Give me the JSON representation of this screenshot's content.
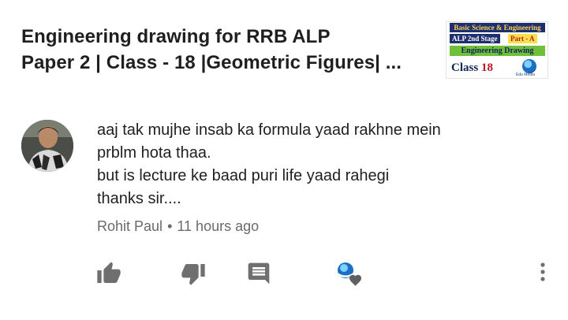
{
  "video": {
    "title_line1": "Engineering drawing for RRB ALP",
    "title_line2": "Paper 2 | Class - 18 |Geometric Figures| ...",
    "thumbnail": {
      "line1": "Basic Science & Engineering",
      "stage": "ALP 2nd Stage",
      "part": "Part - A",
      "subject": "Engineering Drawing",
      "class_label": "Class",
      "class_number": "18",
      "logo_text": "Edu Media"
    }
  },
  "comment": {
    "lines": [
      "aaj tak mujhe insab ka formula yaad rakhne mein",
      "prblm hota thaa.",
      "but is lecture ke baad puri life yaad rahegi",
      "thanks sir...."
    ],
    "author": "Rohit Paul",
    "separator": "•",
    "time": "11 hours ago"
  },
  "actions": {
    "like_icon": "thumbs-up-icon",
    "dislike_icon": "thumbs-down-icon",
    "reply_icon": "reply-comment-icon",
    "heart_icon": "creator-heart-icon",
    "more_icon": "more-vertical-icon"
  },
  "colors": {
    "text": "#1f1f1f",
    "meta": "#6a6a6a",
    "icon": "#6f6f6f"
  }
}
